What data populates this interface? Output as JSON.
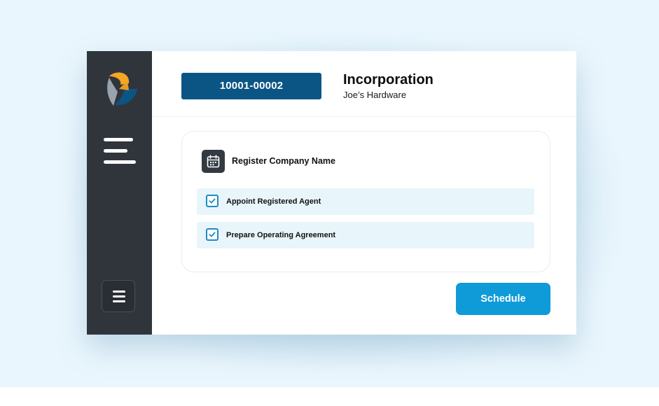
{
  "header": {
    "case_id": "10001-00002",
    "title": "Incorporation",
    "subtitle": "Joe’s Hardware"
  },
  "task": {
    "title": "Register Company Name",
    "icon": "calendar-icon",
    "subtasks": [
      {
        "label": "Appoint Registered Agent",
        "checked": true
      },
      {
        "label": "Prepare Operating Agreement",
        "checked": true
      }
    ]
  },
  "actions": {
    "schedule_label": "Schedule"
  },
  "sidebar": {
    "logo": "brand-logo",
    "nav_icon": "hamburger-icon",
    "menu_icon": "menu-icon"
  },
  "colors": {
    "backdrop": "#eaf6fd",
    "sidebar": "#30353c",
    "case_badge": "#0b5585",
    "accent": "#0f9ad8",
    "row_background": "#e8f5fb",
    "checkbox": "#1e8cc3",
    "logo_orange": "#f5a623",
    "logo_blue": "#0b5585",
    "logo_gray": "#9aa3ab"
  }
}
